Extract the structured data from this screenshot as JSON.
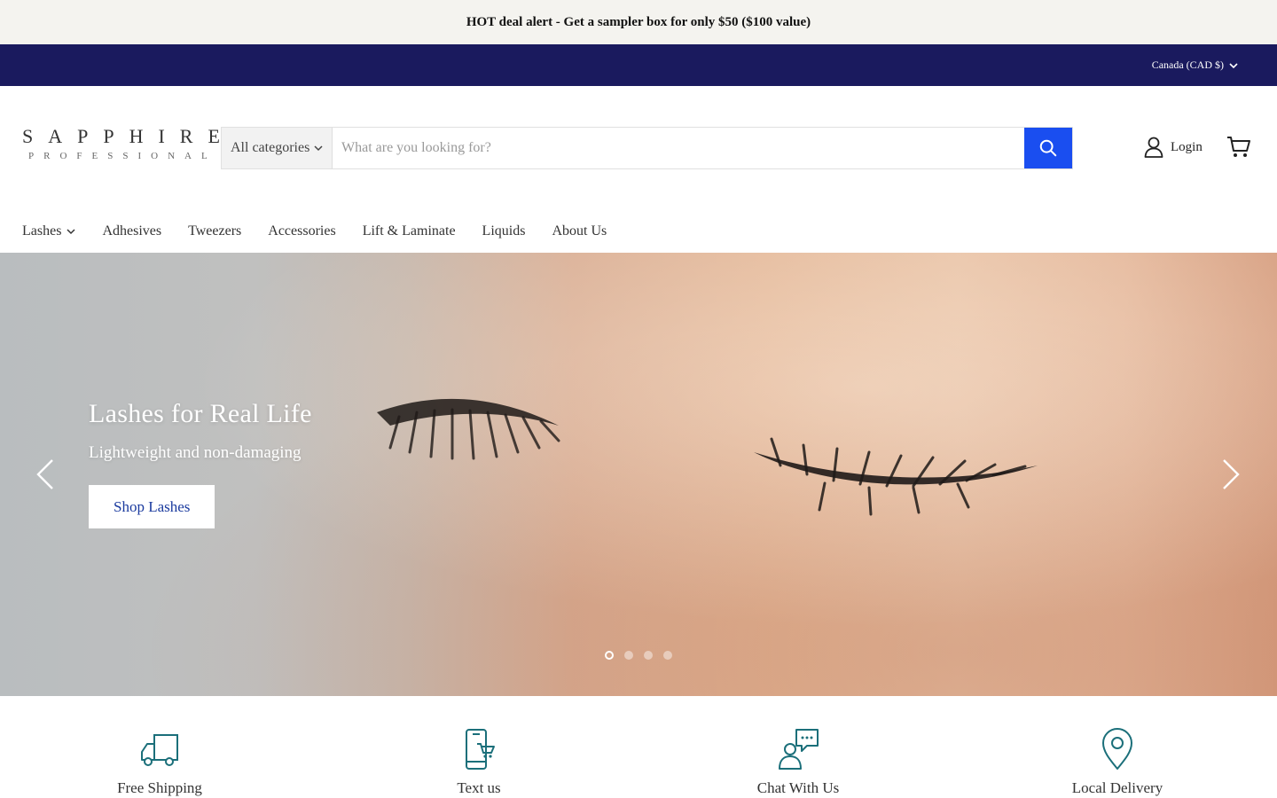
{
  "announcement": "HOT deal alert - Get a sampler box for only $50 ($100 value)",
  "utility": {
    "currency": "Canada (CAD $)"
  },
  "header": {
    "logo_main": "SAPPHIRE",
    "logo_sub": "PROFESSIONAL",
    "search": {
      "category": "All categories",
      "placeholder": "What are you looking for?",
      "value": ""
    },
    "login": "Login"
  },
  "nav": {
    "items": [
      "Lashes",
      "Adhesives",
      "Tweezers",
      "Accessories",
      "Lift & Laminate",
      "Liquids",
      "About Us"
    ]
  },
  "hero": {
    "title": "Lashes for Real Life",
    "subtitle": "Lightweight and non-damaging",
    "button": "Shop Lashes",
    "slides": 4,
    "active_slide": 1
  },
  "features": [
    {
      "label": "Free Shipping",
      "icon": "truck-icon"
    },
    {
      "label": "Text us",
      "icon": "phone-cart-icon"
    },
    {
      "label": "Chat With Us",
      "icon": "chat-person-icon"
    },
    {
      "label": "Local Delivery",
      "icon": "map-pin-icon"
    }
  ],
  "colors": {
    "accent": "#1a4ef0",
    "utility_bar": "#1a1a5e",
    "feature_icon": "#1b6f7a",
    "button_text": "#1a3a9e"
  }
}
